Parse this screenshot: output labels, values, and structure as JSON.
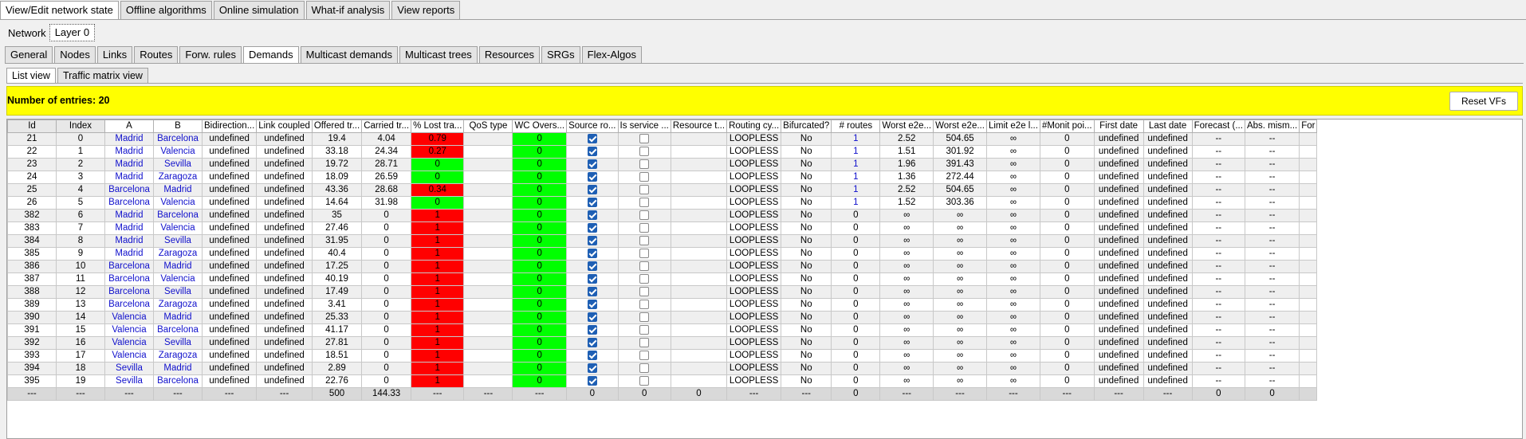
{
  "main_tabs": [
    "View/Edit network state",
    "Offline algorithms",
    "Online simulation",
    "What-if analysis",
    "View reports"
  ],
  "main_tab_active": 0,
  "layer_bar": {
    "label": "Network",
    "layer_tab": "Layer 0"
  },
  "sub_tabs": [
    "General",
    "Nodes",
    "Links",
    "Routes",
    "Forw. rules",
    "Demands",
    "Multicast demands",
    "Multicast trees",
    "Resources",
    "SRGs",
    "Flex-Algos"
  ],
  "sub_tab_active": 5,
  "view_tabs": [
    "List view",
    "Traffic matrix view"
  ],
  "view_tab_active": 0,
  "banner": {
    "entries_text": "Number of entries: 20",
    "reset_button": "Reset VFs"
  },
  "colors": {
    "banner": "#ffff00",
    "lost_red": "#ff0000",
    "ok_green": "#00ff00",
    "link_blue": "#1010cc",
    "checkbox_checked": "#1e5fb4"
  },
  "table": {
    "columns": [
      "Id",
      "Index",
      "A",
      "B",
      "Bidirection...",
      "Link coupled",
      "Offered tr...",
      "Carried tr...",
      "% Lost tra...",
      "QoS type",
      "WC Overs...",
      "Source ro...",
      "Is service ...",
      "Resource t...",
      "Routing cy...",
      "Bifurcated?",
      "# routes",
      "Worst e2e...",
      "Worst e2e...",
      "Limit e2e l...",
      "#Monit poi...",
      "First date",
      "Last date",
      "Forecast (...",
      "Abs. mism...",
      "For"
    ],
    "rows": [
      {
        "id": "21",
        "index": "0",
        "a": "Madrid",
        "b": "Barcelona",
        "bidir": "undefined",
        "coupled": "undefined",
        "offered": "19.4",
        "carried": "4.04",
        "lost": "0.79",
        "qos": "",
        "wc": "0",
        "routes": "1",
        "worst1": "2.52",
        "worst2": "504.65",
        "limit": "∞",
        "monit": "0",
        "first": "undefined",
        "last": "undefined",
        "forecast": "--",
        "absm": "--"
      },
      {
        "id": "22",
        "index": "1",
        "a": "Madrid",
        "b": "Valencia",
        "bidir": "undefined",
        "coupled": "undefined",
        "offered": "33.18",
        "carried": "24.34",
        "lost": "0.27",
        "qos": "",
        "wc": "0",
        "routes": "1",
        "worst1": "1.51",
        "worst2": "301.92",
        "limit": "∞",
        "monit": "0",
        "first": "undefined",
        "last": "undefined",
        "forecast": "--",
        "absm": "--"
      },
      {
        "id": "23",
        "index": "2",
        "a": "Madrid",
        "b": "Sevilla",
        "bidir": "undefined",
        "coupled": "undefined",
        "offered": "19.72",
        "carried": "28.71",
        "lost": "0",
        "qos": "",
        "wc": "0",
        "routes": "1",
        "worst1": "1.96",
        "worst2": "391.43",
        "limit": "∞",
        "monit": "0",
        "first": "undefined",
        "last": "undefined",
        "forecast": "--",
        "absm": "--"
      },
      {
        "id": "24",
        "index": "3",
        "a": "Madrid",
        "b": "Zaragoza",
        "bidir": "undefined",
        "coupled": "undefined",
        "offered": "18.09",
        "carried": "26.59",
        "lost": "0",
        "qos": "",
        "wc": "0",
        "routes": "1",
        "worst1": "1.36",
        "worst2": "272.44",
        "limit": "∞",
        "monit": "0",
        "first": "undefined",
        "last": "undefined",
        "forecast": "--",
        "absm": "--"
      },
      {
        "id": "25",
        "index": "4",
        "a": "Barcelona",
        "b": "Madrid",
        "bidir": "undefined",
        "coupled": "undefined",
        "offered": "43.36",
        "carried": "28.68",
        "lost": "0.34",
        "qos": "",
        "wc": "0",
        "routes": "1",
        "worst1": "2.52",
        "worst2": "504.65",
        "limit": "∞",
        "monit": "0",
        "first": "undefined",
        "last": "undefined",
        "forecast": "--",
        "absm": "--"
      },
      {
        "id": "26",
        "index": "5",
        "a": "Barcelona",
        "b": "Valencia",
        "bidir": "undefined",
        "coupled": "undefined",
        "offered": "14.64",
        "carried": "31.98",
        "lost": "0",
        "qos": "",
        "wc": "0",
        "routes": "1",
        "worst1": "1.52",
        "worst2": "303.36",
        "limit": "∞",
        "monit": "0",
        "first": "undefined",
        "last": "undefined",
        "forecast": "--",
        "absm": "--"
      },
      {
        "id": "382",
        "index": "6",
        "a": "Madrid",
        "b": "Barcelona",
        "bidir": "undefined",
        "coupled": "undefined",
        "offered": "35",
        "carried": "0",
        "lost": "1",
        "qos": "",
        "wc": "0",
        "routes": "0",
        "worst1": "∞",
        "worst2": "∞",
        "limit": "∞",
        "monit": "0",
        "first": "undefined",
        "last": "undefined",
        "forecast": "--",
        "absm": "--"
      },
      {
        "id": "383",
        "index": "7",
        "a": "Madrid",
        "b": "Valencia",
        "bidir": "undefined",
        "coupled": "undefined",
        "offered": "27.46",
        "carried": "0",
        "lost": "1",
        "qos": "",
        "wc": "0",
        "routes": "0",
        "worst1": "∞",
        "worst2": "∞",
        "limit": "∞",
        "monit": "0",
        "first": "undefined",
        "last": "undefined",
        "forecast": "--",
        "absm": "--"
      },
      {
        "id": "384",
        "index": "8",
        "a": "Madrid",
        "b": "Sevilla",
        "bidir": "undefined",
        "coupled": "undefined",
        "offered": "31.95",
        "carried": "0",
        "lost": "1",
        "qos": "",
        "wc": "0",
        "routes": "0",
        "worst1": "∞",
        "worst2": "∞",
        "limit": "∞",
        "monit": "0",
        "first": "undefined",
        "last": "undefined",
        "forecast": "--",
        "absm": "--"
      },
      {
        "id": "385",
        "index": "9",
        "a": "Madrid",
        "b": "Zaragoza",
        "bidir": "undefined",
        "coupled": "undefined",
        "offered": "40.4",
        "carried": "0",
        "lost": "1",
        "qos": "",
        "wc": "0",
        "routes": "0",
        "worst1": "∞",
        "worst2": "∞",
        "limit": "∞",
        "monit": "0",
        "first": "undefined",
        "last": "undefined",
        "forecast": "--",
        "absm": "--"
      },
      {
        "id": "386",
        "index": "10",
        "a": "Barcelona",
        "b": "Madrid",
        "bidir": "undefined",
        "coupled": "undefined",
        "offered": "17.25",
        "carried": "0",
        "lost": "1",
        "qos": "",
        "wc": "0",
        "routes": "0",
        "worst1": "∞",
        "worst2": "∞",
        "limit": "∞",
        "monit": "0",
        "first": "undefined",
        "last": "undefined",
        "forecast": "--",
        "absm": "--"
      },
      {
        "id": "387",
        "index": "11",
        "a": "Barcelona",
        "b": "Valencia",
        "bidir": "undefined",
        "coupled": "undefined",
        "offered": "40.19",
        "carried": "0",
        "lost": "1",
        "qos": "",
        "wc": "0",
        "routes": "0",
        "worst1": "∞",
        "worst2": "∞",
        "limit": "∞",
        "monit": "0",
        "first": "undefined",
        "last": "undefined",
        "forecast": "--",
        "absm": "--"
      },
      {
        "id": "388",
        "index": "12",
        "a": "Barcelona",
        "b": "Sevilla",
        "bidir": "undefined",
        "coupled": "undefined",
        "offered": "17.49",
        "carried": "0",
        "lost": "1",
        "qos": "",
        "wc": "0",
        "routes": "0",
        "worst1": "∞",
        "worst2": "∞",
        "limit": "∞",
        "monit": "0",
        "first": "undefined",
        "last": "undefined",
        "forecast": "--",
        "absm": "--"
      },
      {
        "id": "389",
        "index": "13",
        "a": "Barcelona",
        "b": "Zaragoza",
        "bidir": "undefined",
        "coupled": "undefined",
        "offered": "3.41",
        "carried": "0",
        "lost": "1",
        "qos": "",
        "wc": "0",
        "routes": "0",
        "worst1": "∞",
        "worst2": "∞",
        "limit": "∞",
        "monit": "0",
        "first": "undefined",
        "last": "undefined",
        "forecast": "--",
        "absm": "--"
      },
      {
        "id": "390",
        "index": "14",
        "a": "Valencia",
        "b": "Madrid",
        "bidir": "undefined",
        "coupled": "undefined",
        "offered": "25.33",
        "carried": "0",
        "lost": "1",
        "qos": "",
        "wc": "0",
        "routes": "0",
        "worst1": "∞",
        "worst2": "∞",
        "limit": "∞",
        "monit": "0",
        "first": "undefined",
        "last": "undefined",
        "forecast": "--",
        "absm": "--"
      },
      {
        "id": "391",
        "index": "15",
        "a": "Valencia",
        "b": "Barcelona",
        "bidir": "undefined",
        "coupled": "undefined",
        "offered": "41.17",
        "carried": "0",
        "lost": "1",
        "qos": "",
        "wc": "0",
        "routes": "0",
        "worst1": "∞",
        "worst2": "∞",
        "limit": "∞",
        "monit": "0",
        "first": "undefined",
        "last": "undefined",
        "forecast": "--",
        "absm": "--"
      },
      {
        "id": "392",
        "index": "16",
        "a": "Valencia",
        "b": "Sevilla",
        "bidir": "undefined",
        "coupled": "undefined",
        "offered": "27.81",
        "carried": "0",
        "lost": "1",
        "qos": "",
        "wc": "0",
        "routes": "0",
        "worst1": "∞",
        "worst2": "∞",
        "limit": "∞",
        "monit": "0",
        "first": "undefined",
        "last": "undefined",
        "forecast": "--",
        "absm": "--"
      },
      {
        "id": "393",
        "index": "17",
        "a": "Valencia",
        "b": "Zaragoza",
        "bidir": "undefined",
        "coupled": "undefined",
        "offered": "18.51",
        "carried": "0",
        "lost": "1",
        "qos": "",
        "wc": "0",
        "routes": "0",
        "worst1": "∞",
        "worst2": "∞",
        "limit": "∞",
        "monit": "0",
        "first": "undefined",
        "last": "undefined",
        "forecast": "--",
        "absm": "--"
      },
      {
        "id": "394",
        "index": "18",
        "a": "Sevilla",
        "b": "Madrid",
        "bidir": "undefined",
        "coupled": "undefined",
        "offered": "2.89",
        "carried": "0",
        "lost": "1",
        "qos": "",
        "wc": "0",
        "routes": "0",
        "worst1": "∞",
        "worst2": "∞",
        "limit": "∞",
        "monit": "0",
        "first": "undefined",
        "last": "undefined",
        "forecast": "--",
        "absm": "--"
      },
      {
        "id": "395",
        "index": "19",
        "a": "Sevilla",
        "b": "Barcelona",
        "bidir": "undefined",
        "coupled": "undefined",
        "offered": "22.76",
        "carried": "0",
        "lost": "1",
        "qos": "",
        "wc": "0",
        "routes": "0",
        "worst1": "∞",
        "worst2": "∞",
        "limit": "∞",
        "monit": "0",
        "first": "undefined",
        "last": "undefined",
        "forecast": "--",
        "absm": "--"
      }
    ],
    "source_routing_checked": true,
    "is_service_chain_checked": false,
    "routing_cycle": "LOOPLESS",
    "bifurcated": "No",
    "totals": [
      "---",
      "---",
      "---",
      "---",
      "---",
      "---",
      "500",
      "144.33",
      "---",
      "---",
      "---",
      "0",
      "0",
      "0",
      "---",
      "---",
      "0",
      "---",
      "---",
      "---",
      "---",
      "---",
      "---",
      "0",
      "0",
      ""
    ]
  }
}
